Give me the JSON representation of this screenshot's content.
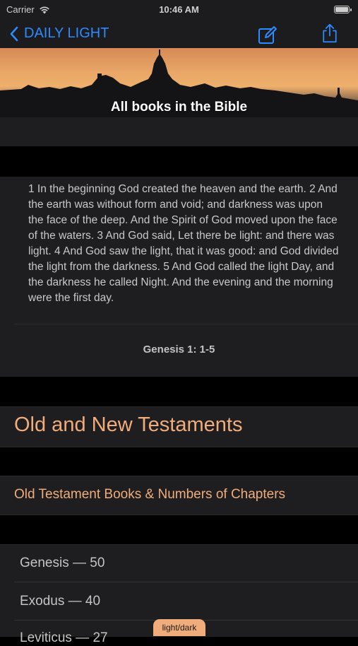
{
  "status_bar": {
    "carrier": "Carrier",
    "time": "10:46 AM"
  },
  "nav": {
    "back_label": "DAILY LIGHT",
    "icons": [
      "chevron-left-icon",
      "compose-icon",
      "share-icon"
    ],
    "accent_color": "#2b8bff"
  },
  "banner": {
    "title": "All books in the Bible"
  },
  "verse_card": {
    "text": "1 In the beginning God created the heaven and the earth. 2 And the earth was without form and void; and darkness was upon the face of the deep. And the Spirit of God moved upon the face of the waters. 3 And God said, Let there be light: and there was light.  4 And God saw the light, that it was good: and God divided the light from the darkness. 5 And God called the light Day, and the darkness he called Night. And the evening and the morning were the first day.",
    "reference": "Genesis 1: 1-5"
  },
  "section": {
    "heading": "Old and New Testaments",
    "subheading": "Old Testament Books & Numbers of Chapters",
    "heading_color": "#f0ac7a"
  },
  "books": [
    {
      "label": "Genesis — 50"
    },
    {
      "label": "Exodus — 40"
    },
    {
      "label": "Leviticus — 27"
    }
  ],
  "theme_toggle": {
    "label": "light/dark"
  }
}
